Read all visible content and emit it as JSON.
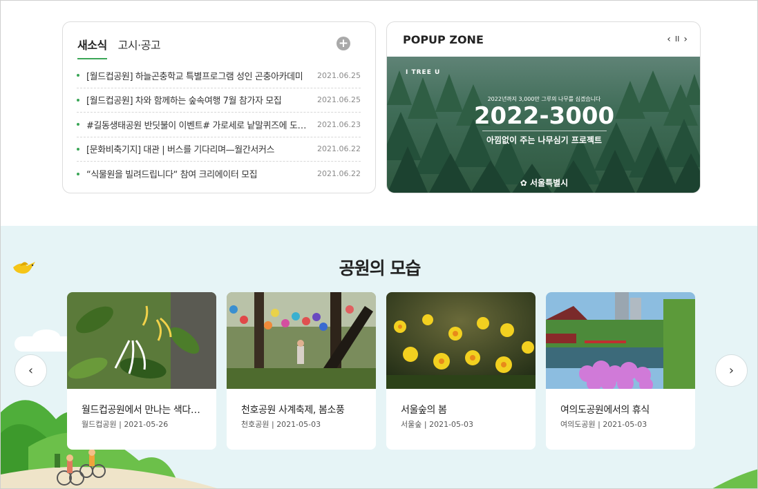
{
  "news": {
    "tabs": [
      {
        "label": "새소식",
        "active": true
      },
      {
        "label": "고시·공고",
        "active": false
      }
    ],
    "more_icon": "plus-circle-icon",
    "items": [
      {
        "title": "[월드컵공원] 하늘곤충학교 특별프로그램 성인 곤충아카데미",
        "date": "2021.06.25"
      },
      {
        "title": "[월드컵공원] 차와 함께하는 숲속여행 7월 참가자 모집",
        "date": "2021.06.25"
      },
      {
        "title": "#길동생태공원 반딧불이 이벤트# 가로세로 낱말퀴즈에 도전하세요",
        "date": "2021.06.23"
      },
      {
        "title": "[문화비축기지] 대관 | 버스를 기다리며—월간서커스",
        "date": "2021.06.22"
      },
      {
        "title": "“식물원을 빌려드립니다“ 참여 크리에이터 모집",
        "date": "2021.06.22"
      }
    ]
  },
  "popup": {
    "title": "POPUP ZONE",
    "controls": {
      "prev": "‹",
      "pause": "II",
      "next": "›"
    },
    "banner": {
      "logo": "I TREE U",
      "subtitle": "2022년까지 3,000만 그루의 나무를 심겠습니다",
      "headline": "2022-3000",
      "description": "아낌없이 주는 나무심기 프로젝트",
      "org": "서울특별시"
    }
  },
  "park": {
    "heading": "공원의 모습",
    "prev_icon": "chevron-left-icon",
    "next_icon": "chevron-right-icon",
    "cards": [
      {
        "title": "월드컵공원에서 만나는 색다른 꽃",
        "location": "월드컵공원",
        "date": "2021-05-26"
      },
      {
        "title": "천호공원 사계축제, 봄소풍",
        "location": "천호공원",
        "date": "2021-05-03"
      },
      {
        "title": "서울숲의 봄",
        "location": "서울숲",
        "date": "2021-05-03"
      },
      {
        "title": "여의도공원에서의 휴식",
        "location": "여의도공원",
        "date": "2021-05-03"
      }
    ]
  }
}
